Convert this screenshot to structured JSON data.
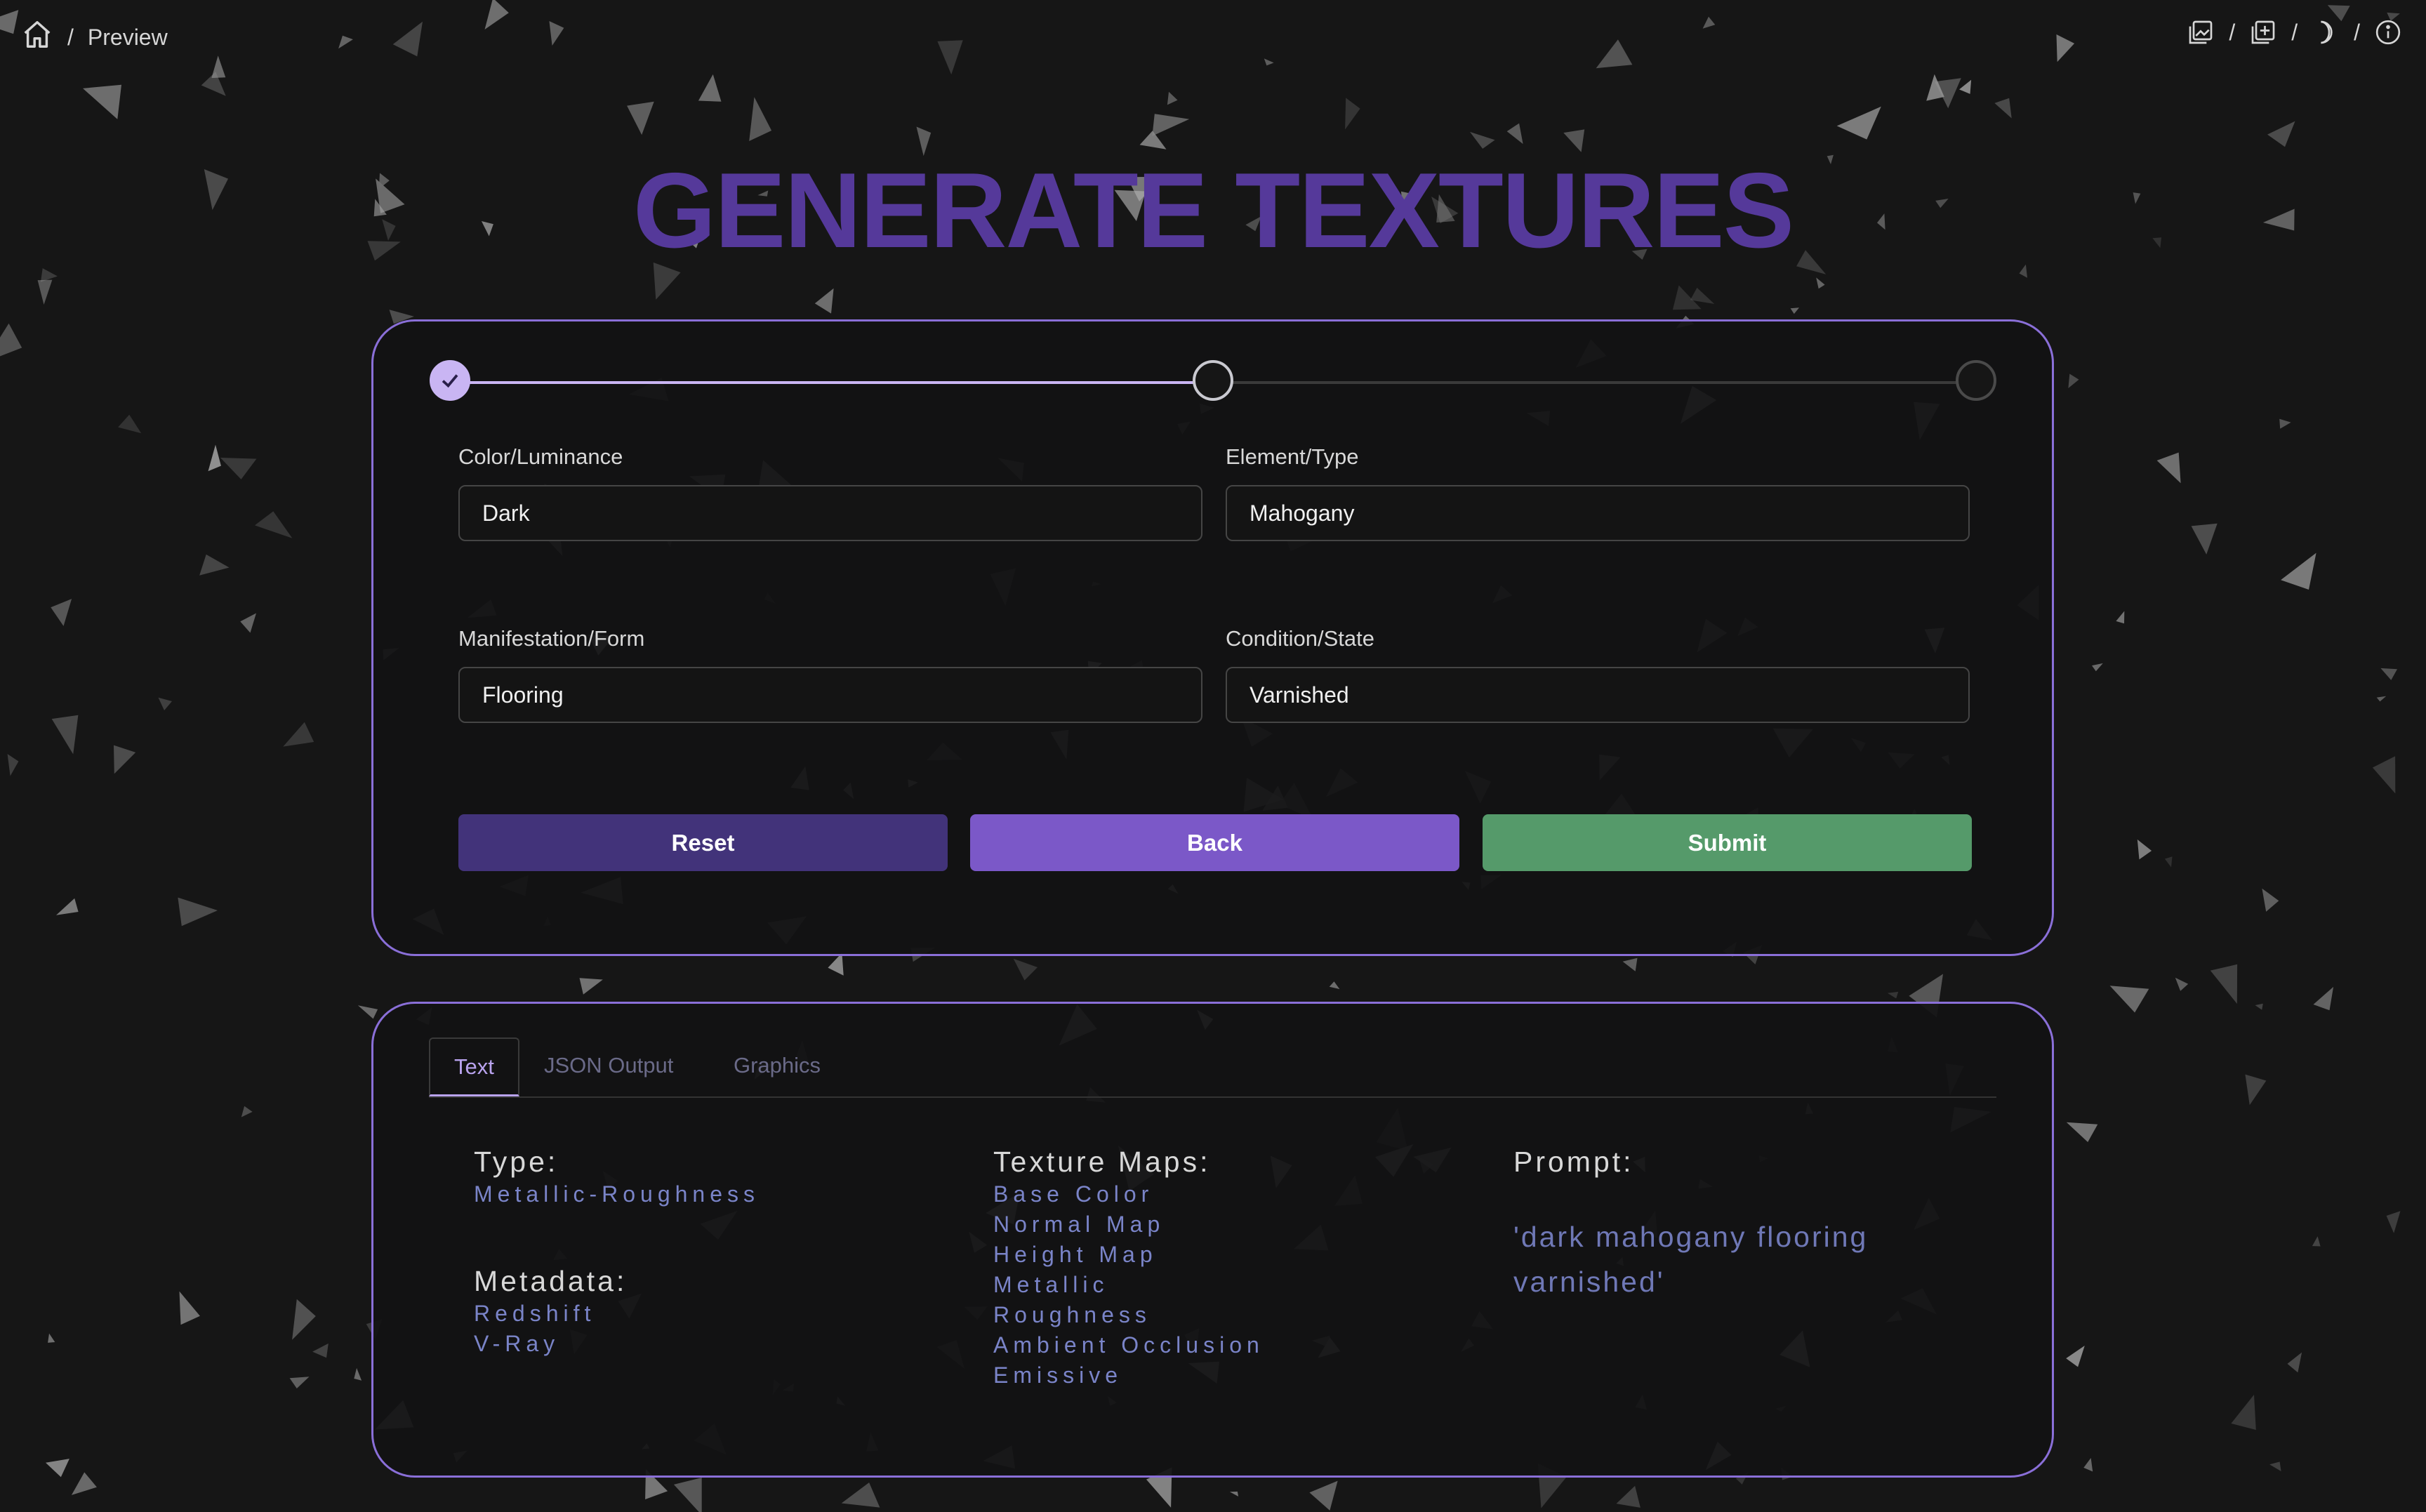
{
  "breadcrumb": {
    "home_icon": "home-icon",
    "separator": "/",
    "current": "Preview"
  },
  "top_icons": [
    {
      "name": "gallery-icon",
      "sep": "/"
    },
    {
      "name": "add-grid-icon",
      "sep": "/"
    },
    {
      "name": "moon-icon",
      "sep": "/"
    },
    {
      "name": "info-icon"
    }
  ],
  "title": "GENERATE TEXTURES",
  "colors": {
    "accent": "#55399a",
    "border": "#8a6fd8",
    "reset": "#42337a",
    "back": "#7b58c8",
    "submit": "#559a6a"
  },
  "stepper": {
    "steps": 3,
    "current": 2,
    "completed": 1
  },
  "form": {
    "color": {
      "label": "Color/Luminance",
      "value": "Dark"
    },
    "element": {
      "label": "Element/Type",
      "value": "Mahogany"
    },
    "manifestation": {
      "label": "Manifestation/Form",
      "value": "Flooring"
    },
    "condition": {
      "label": "Condition/State",
      "value": "Varnished"
    }
  },
  "buttons": {
    "reset": "Reset",
    "back": "Back",
    "submit": "Submit"
  },
  "tabs": [
    {
      "label": "Text",
      "active": true
    },
    {
      "label": "JSON Output",
      "active": false
    },
    {
      "label": "Graphics",
      "active": false
    }
  ],
  "output": {
    "type_label": "Type:",
    "type_value": "Metallic-Roughness",
    "metadata_label": "Metadata:",
    "metadata": [
      "Redshift",
      "V-Ray"
    ],
    "maps_label": "Texture Maps:",
    "maps": [
      "Base Color",
      "Normal Map",
      "Height Map",
      "Metallic",
      "Roughness",
      "Ambient Occlusion",
      "Emissive"
    ],
    "prompt_label": "Prompt:",
    "prompt_value": "'dark mahogany flooring varnished'"
  }
}
